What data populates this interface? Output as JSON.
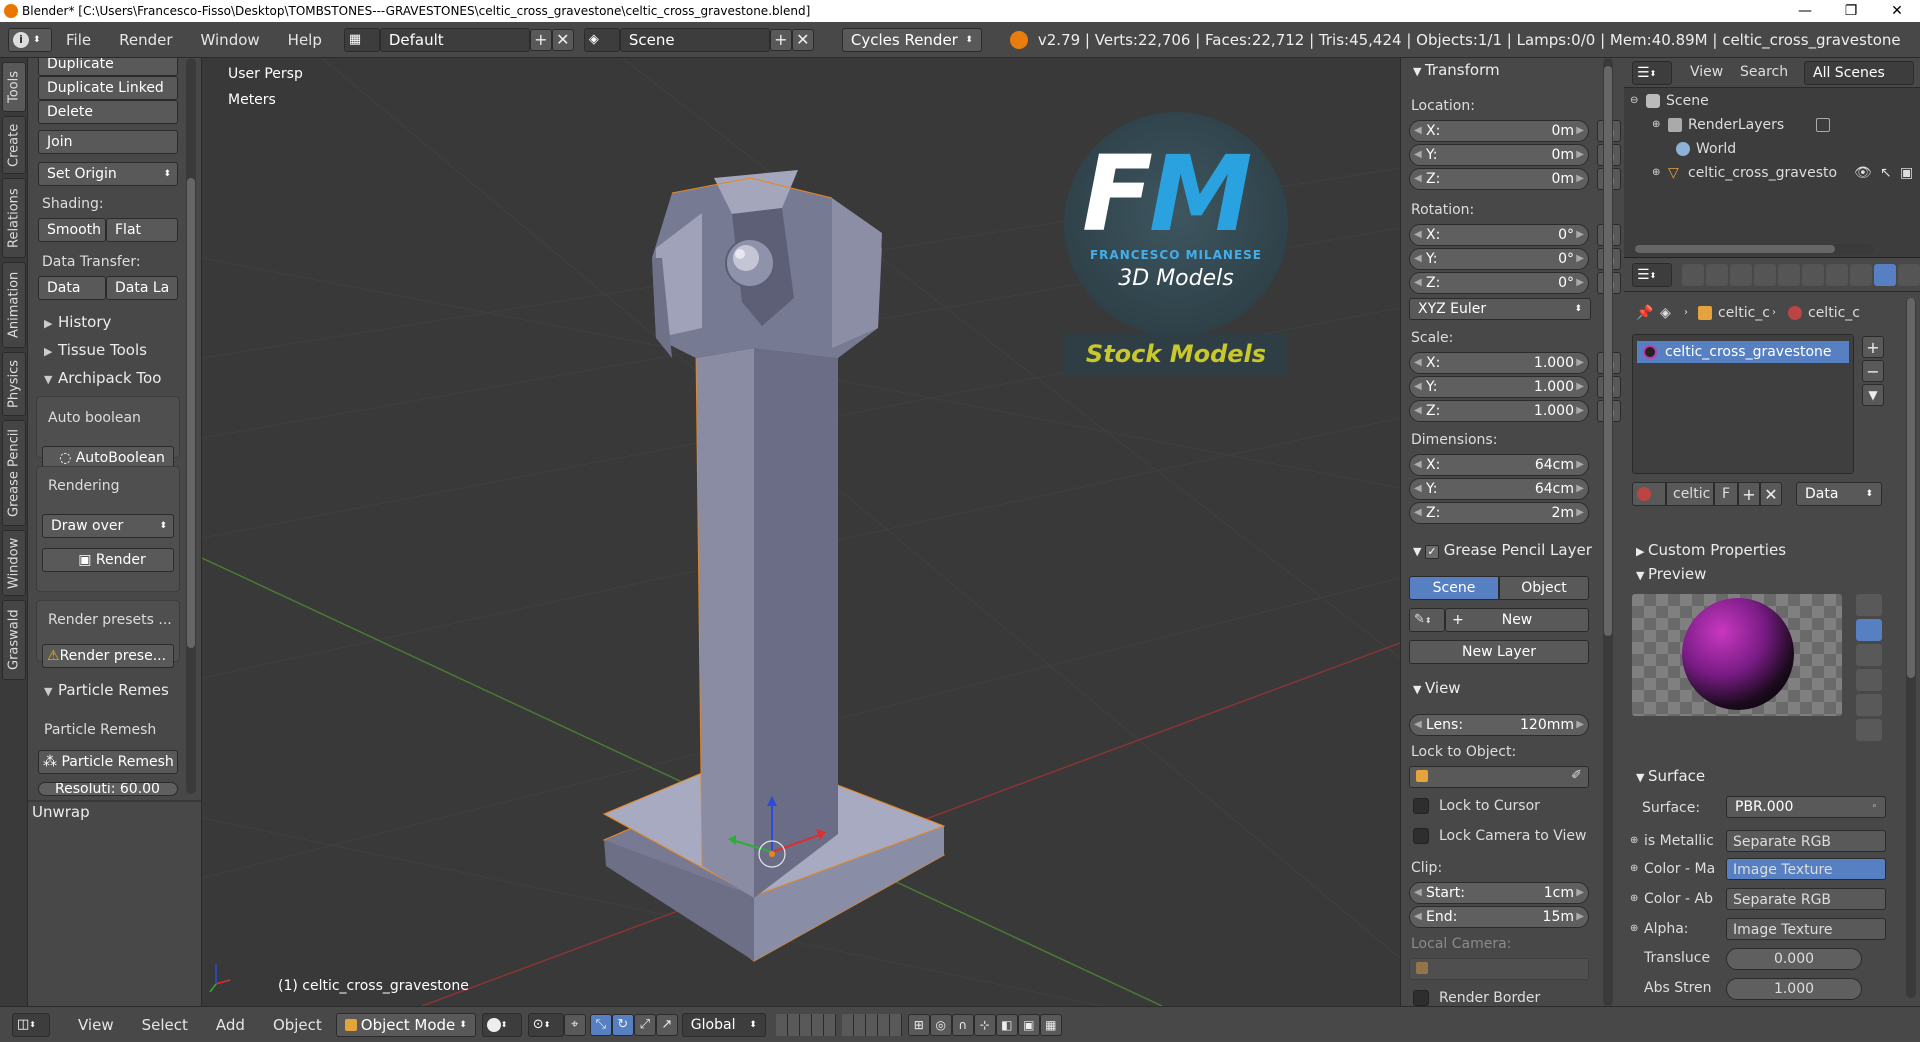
{
  "window": {
    "title": "Blender* [C:\\Users\\Francesco-Fisso\\Desktop\\TOMBSTONES---GRAVESTONES\\celtic_cross_gravestone\\celtic_cross_gravestone.blend]",
    "minimize": "—",
    "maximize": "❐",
    "close": "✕"
  },
  "infobar": {
    "menus": [
      "File",
      "Render",
      "Window",
      "Help"
    ],
    "screen_layout": "Default",
    "scene": "Scene",
    "engine": "Cycles Render",
    "stats": "v2.79 | Verts:22,706 | Faces:22,712 | Tris:45,424 | Objects:1/1 | Lamps:0/0 | Mem:40.89M | celtic_cross_gravestone"
  },
  "toolshelf": {
    "tabs": [
      "Tools",
      "Create",
      "Relations",
      "Animation",
      "Physics",
      "Grease Pencil",
      "Window",
      "Graswald"
    ],
    "buttons_top": [
      "Duplicate",
      "Duplicate Linked",
      "Delete"
    ],
    "join": "Join",
    "set_origin": "Set Origin",
    "shading_label": "Shading:",
    "smooth": "Smooth",
    "flat": "Flat",
    "data_transfer_label": "Data Transfer:",
    "data": "Data",
    "data_la": "Data La",
    "history": "History",
    "tissue_tools": "Tissue Tools",
    "archipack": "Archipack Too",
    "auto_boolean_label": "Auto boolean",
    "autoboolean_btn": "AutoBoolean",
    "rendering_label": "Rendering",
    "draw_over": "Draw over",
    "render_btn": "Render",
    "render_presets_label": "Render presets ...",
    "render_presets_btn": "Render prese...",
    "particle_remesh_hdr": "Particle Remes",
    "particle_remesh_label": "Particle Remesh",
    "particle_remesh_btn": "Particle Remesh",
    "resolution": "Resoluti: 60.00",
    "unwrap": "Unwrap"
  },
  "viewport": {
    "view_name": "User Persp",
    "units": "Meters",
    "object_label": "(1) celtic_cross_gravestone",
    "logo_letters": "FM",
    "logo_name": "FRANCESCO MILANESE",
    "logo_sub": "3D Models",
    "logo_banner": "Stock Models"
  },
  "transform": {
    "header": "Transform",
    "location_label": "Location:",
    "location": [
      {
        "axis": "X:",
        "value": "0m"
      },
      {
        "axis": "Y:",
        "value": "0m"
      },
      {
        "axis": "Z:",
        "value": "0m"
      }
    ],
    "rotation_label": "Rotation:",
    "rotation": [
      {
        "axis": "X:",
        "value": "0°"
      },
      {
        "axis": "Y:",
        "value": "0°"
      },
      {
        "axis": "Z:",
        "value": "0°"
      }
    ],
    "rotation_mode": "XYZ Euler",
    "scale_label": "Scale:",
    "scale": [
      {
        "axis": "X:",
        "value": "1.000"
      },
      {
        "axis": "Y:",
        "value": "1.000"
      },
      {
        "axis": "Z:",
        "value": "1.000"
      }
    ],
    "dimensions_label": "Dimensions:",
    "dimensions": [
      {
        "axis": "X:",
        "value": "64cm"
      },
      {
        "axis": "Y:",
        "value": "64cm"
      },
      {
        "axis": "Z:",
        "value": "2m"
      }
    ]
  },
  "grease_pencil": {
    "header": "Grease Pencil Layer",
    "scene_tab": "Scene",
    "object_tab": "Object",
    "new_btn": "New",
    "new_layer": "New Layer"
  },
  "view_panel": {
    "header": "View",
    "lens_label": "Lens:",
    "lens_value": "120mm",
    "lock_to_object": "Lock to Object:",
    "lock_to_cursor": "Lock to Cursor",
    "lock_camera": "Lock Camera to View",
    "clip_label": "Clip:",
    "start_label": "Start:",
    "start_value": "1cm",
    "end_label": "End:",
    "end_value": "15m",
    "local_camera": "Local Camera:",
    "render_border": "Render Border"
  },
  "outliner": {
    "menus": [
      "View",
      "Search"
    ],
    "filter": "All Scenes",
    "items": [
      {
        "label": "Scene",
        "indent": 0
      },
      {
        "label": "RenderLayers",
        "indent": 1
      },
      {
        "label": "World",
        "indent": 1
      },
      {
        "label": "celtic_cross_gravestone",
        "indent": 1
      }
    ]
  },
  "properties": {
    "breadcrumb_1": "celtic_c",
    "breadcrumb_2": "celtic_c",
    "material_slot": "celtic_cross_gravestone",
    "material_name": "celtic",
    "fake_user": "F",
    "link_mode": "Data",
    "custom_properties": "Custom Properties",
    "preview": "Preview",
    "surface_hdr": "Surface",
    "surface_label": "Surface:",
    "surface_value": "PBR.000",
    "inputs": [
      {
        "label": "is Metallic",
        "value": "Separate RGB"
      },
      {
        "label": "Color - Ma",
        "value": "Image Texture"
      },
      {
        "label": "Color - Ab",
        "value": "Separate RGB"
      },
      {
        "label": "Alpha:",
        "value": "Image Texture"
      }
    ],
    "transluce_label": "Transluce",
    "transluce_value": "0.000",
    "abs_label": "Abs Stren",
    "abs_value": "1.000",
    "accent": "#5680c2"
  },
  "statusbar": {
    "menus": [
      "View",
      "Select",
      "Add",
      "Object"
    ],
    "mode": "Object Mode",
    "orientation": "Global"
  }
}
